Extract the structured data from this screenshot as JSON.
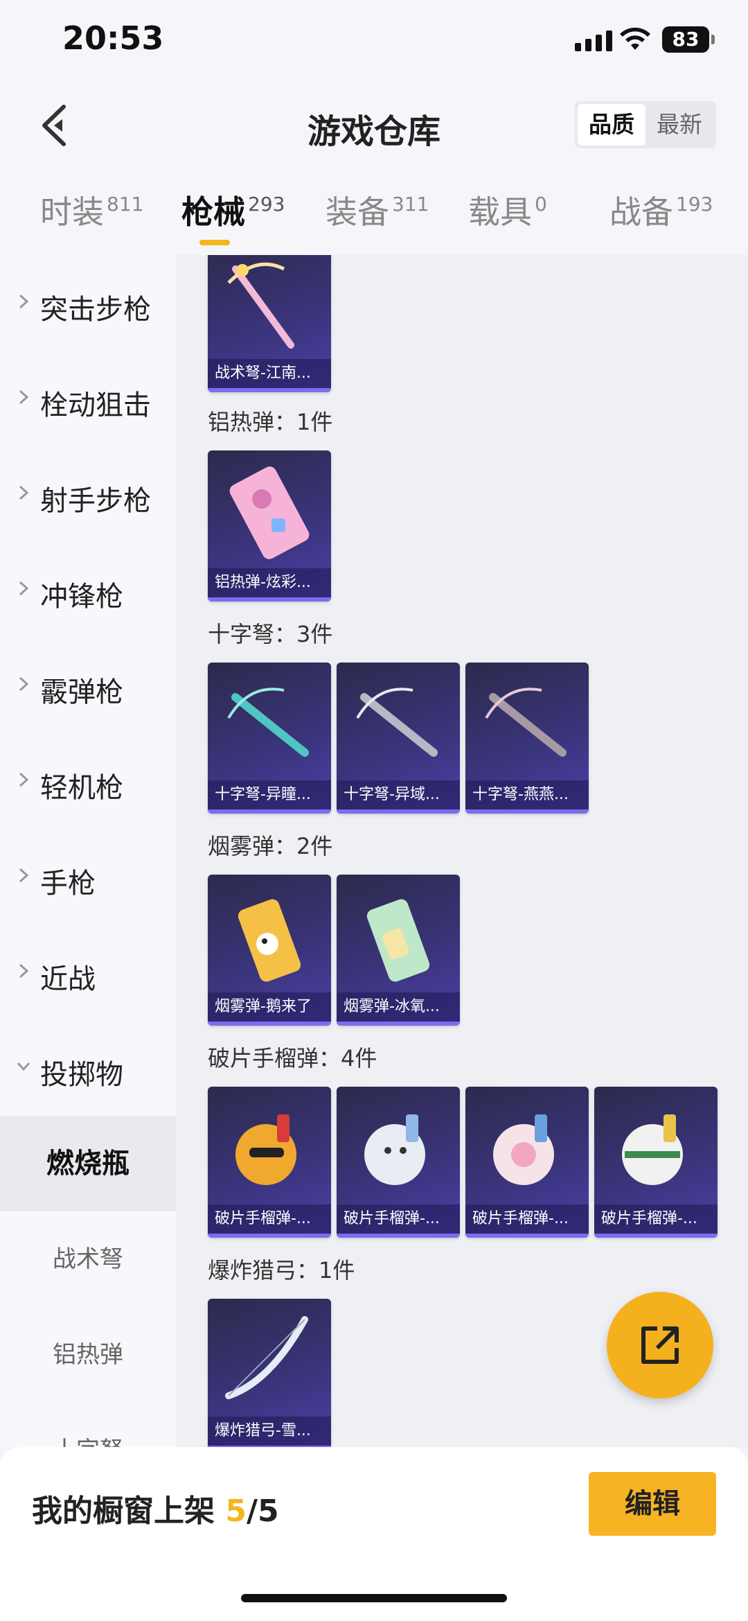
{
  "status": {
    "time": "20:53",
    "battery": "83"
  },
  "header": {
    "title": "游戏仓库",
    "sort_options": [
      "品质",
      "最新"
    ]
  },
  "tabs": [
    {
      "label": "时装",
      "count": "811"
    },
    {
      "label": "枪械",
      "count": "293"
    },
    {
      "label": "装备",
      "count": "311"
    },
    {
      "label": "载具",
      "count": "0"
    },
    {
      "label": "战备",
      "count": "193"
    }
  ],
  "sidebar": {
    "categories": [
      "突击步枪",
      "栓动狙击",
      "射手步枪",
      "冲锋枪",
      "霰弹枪",
      "轻机枪",
      "手枪",
      "近战",
      "投掷物"
    ],
    "subcategories": [
      "燃烧瓶",
      "战术弩",
      "铝热弹",
      "十字弩"
    ]
  },
  "groups": [
    {
      "label": "铝热弹：1件",
      "items": [
        "铝热弹-炫彩..."
      ]
    },
    {
      "label": "十字弩：3件",
      "items": [
        "十字弩-异瞳...",
        "十字弩-异域...",
        "十字弩-燕燕..."
      ]
    },
    {
      "label": "烟雾弹：2件",
      "items": [
        "烟雾弹-鹅来了",
        "烟雾弹-冰氧..."
      ]
    },
    {
      "label": "破片手榴弹：4件",
      "items": [
        "破片手榴弹-...",
        "破片手榴弹-...",
        "破片手榴弹-...",
        "破片手榴弹-..."
      ]
    },
    {
      "label": "爆炸猎弓：1件",
      "items": [
        "爆炸猎弓-雪..."
      ]
    }
  ],
  "top_item": "战术弩-江南...",
  "bottom": {
    "shelf_label": "我的橱窗上架",
    "shelf_count": "5",
    "shelf_total": "/5",
    "edit_label": "编辑"
  },
  "colors": {
    "accent": "#f5b51c",
    "card_bg": "#3a347a"
  }
}
